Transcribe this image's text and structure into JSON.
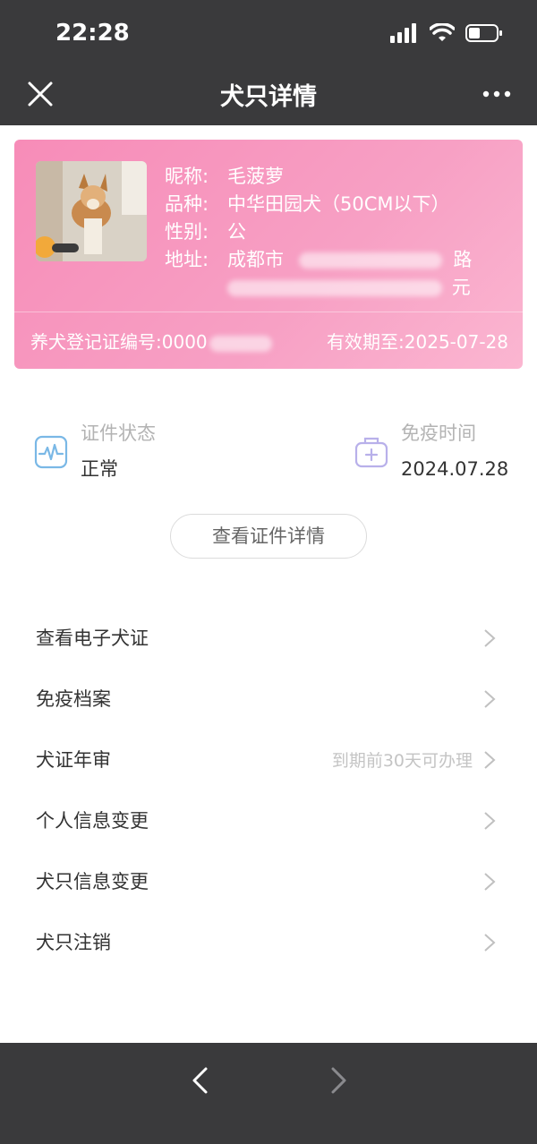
{
  "status_bar": {
    "time": "22:28"
  },
  "nav": {
    "title": "犬只详情",
    "close_icon": "close-icon",
    "more_icon": "more-icon"
  },
  "card": {
    "nickname_label": "昵称:",
    "nickname": "毛菠萝",
    "breed_label": "品种:",
    "breed": "中华田园犬（50CM以下）",
    "gender_label": "性别:",
    "gender": "公",
    "address_label": "地址:",
    "address_prefix": "成都市",
    "address_suffix_1": "路",
    "address_suffix_2": "元",
    "reg_label": "养犬登记证编号:",
    "reg_number_visible": "0000",
    "valid_label": "有效期至:",
    "valid_until": "2025-07-28",
    "background_color": "#f78cb8"
  },
  "stats": {
    "cert_status_label": "证件状态",
    "cert_status_value": "正常",
    "vaccine_time_label": "免疫时间",
    "vaccine_time_value": "2024.07.28"
  },
  "detail_button": "查看证件详情",
  "menu": [
    {
      "label": "查看电子犬证",
      "hint": ""
    },
    {
      "label": "免疫档案",
      "hint": ""
    },
    {
      "label": "犬证年审",
      "hint": "到期前30天可办理"
    },
    {
      "label": "个人信息变更",
      "hint": ""
    },
    {
      "label": "犬只信息变更",
      "hint": ""
    },
    {
      "label": "犬只注销",
      "hint": ""
    }
  ],
  "colors": {
    "header_bg": "#3a3a3c",
    "card_pink": "#f78cb8",
    "icon_blue": "#7ab8e6",
    "icon_purple": "#b8b0ea"
  }
}
